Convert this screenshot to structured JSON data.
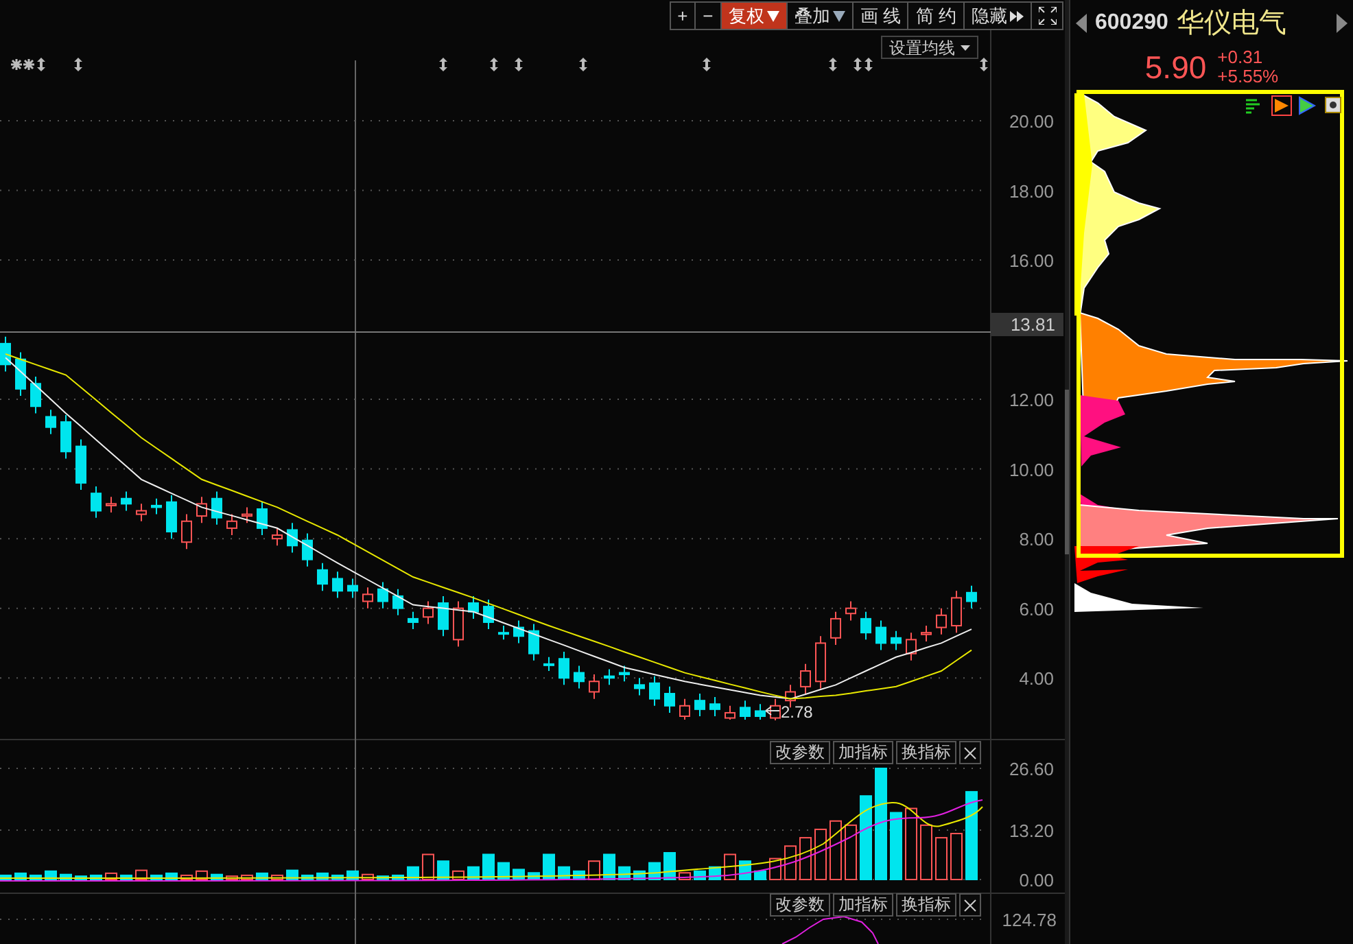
{
  "toolbar": {
    "buttons": [
      {
        "kind": "text",
        "label": "+",
        "selected": false
      },
      {
        "kind": "text",
        "label": "−",
        "selected": false
      },
      {
        "kind": "dropdown",
        "label": "复权",
        "selected": true
      },
      {
        "kind": "dropdown",
        "label": "叠加",
        "selected": false
      },
      {
        "kind": "text",
        "label": "画 线",
        "selected": false
      },
      {
        "kind": "text",
        "label": "简 约",
        "selected": false
      },
      {
        "kind": "expand",
        "label": "隐藏",
        "selected": false
      },
      {
        "kind": "fullscreen",
        "selected": false
      }
    ]
  },
  "price_chart": {
    "ma_button": "设置均线",
    "crosshair_price": "13.81",
    "low_label": "2.78",
    "chart_data": {
      "type": "candlestick",
      "grid": true,
      "ylim": [
        -3.64,
        22.6
      ],
      "yticks": [
        {
          "value": 20,
          "label": "20.00"
        },
        {
          "value": 18,
          "label": "18.00"
        },
        {
          "value": 16,
          "label": "16.00"
        },
        {
          "value": 12,
          "label": "12.00"
        },
        {
          "value": 10,
          "label": "10.00"
        },
        {
          "value": 8,
          "label": "8.00"
        },
        {
          "value": 6,
          "label": "6.00"
        },
        {
          "value": 4,
          "label": "4.00"
        }
      ],
      "ohlc": [
        [
          13.6,
          13.8,
          12.8,
          13.0
        ],
        [
          13.15,
          13.35,
          12.1,
          12.3
        ],
        [
          12.45,
          12.65,
          11.6,
          11.8
        ],
        [
          11.5,
          11.7,
          11.0,
          11.2
        ],
        [
          11.35,
          11.55,
          10.3,
          10.5
        ],
        [
          10.65,
          10.85,
          9.4,
          9.6
        ],
        [
          9.3,
          9.5,
          8.6,
          8.8
        ],
        [
          8.95,
          9.2,
          8.75,
          9.0
        ],
        [
          9.15,
          9.35,
          8.8,
          9.0
        ],
        [
          8.7,
          9.0,
          8.5,
          8.8
        ],
        [
          8.95,
          9.15,
          8.7,
          8.9
        ],
        [
          9.05,
          9.25,
          8.0,
          8.2
        ],
        [
          7.9,
          8.7,
          7.7,
          8.5
        ],
        [
          8.65,
          9.2,
          8.45,
          9.0
        ],
        [
          9.15,
          9.35,
          8.4,
          8.6
        ],
        [
          8.3,
          8.7,
          8.1,
          8.5
        ],
        [
          8.65,
          8.9,
          8.45,
          8.7
        ],
        [
          8.85,
          9.05,
          8.1,
          8.3
        ],
        [
          8.0,
          8.3,
          7.8,
          8.1
        ],
        [
          8.25,
          8.45,
          7.6,
          7.8
        ],
        [
          7.95,
          8.15,
          7.2,
          7.4
        ],
        [
          7.1,
          7.3,
          6.5,
          6.7
        ],
        [
          6.85,
          7.05,
          6.3,
          6.5
        ],
        [
          6.65,
          6.85,
          6.3,
          6.5
        ],
        [
          6.2,
          6.6,
          6.0,
          6.4
        ],
        [
          6.55,
          6.75,
          6.0,
          6.2
        ],
        [
          6.35,
          6.55,
          5.8,
          6.0
        ],
        [
          5.7,
          5.9,
          5.4,
          5.6
        ],
        [
          5.75,
          6.2,
          5.55,
          6.0
        ],
        [
          6.15,
          6.35,
          5.2,
          5.4
        ],
        [
          5.1,
          6.2,
          4.9,
          6.0
        ],
        [
          6.15,
          6.35,
          5.7,
          5.9
        ],
        [
          6.05,
          6.25,
          5.4,
          5.6
        ],
        [
          5.3,
          5.5,
          5.1,
          5.3
        ],
        [
          5.45,
          5.65,
          5.0,
          5.2
        ],
        [
          5.35,
          5.55,
          4.5,
          4.7
        ],
        [
          4.4,
          4.6,
          4.2,
          4.4
        ],
        [
          4.55,
          4.75,
          3.8,
          4.0
        ],
        [
          4.15,
          4.35,
          3.7,
          3.9
        ],
        [
          3.6,
          4.1,
          3.4,
          3.9
        ],
        [
          4.05,
          4.25,
          3.8,
          4.0
        ],
        [
          4.15,
          4.35,
          3.9,
          4.1
        ],
        [
          3.8,
          4.0,
          3.5,
          3.7
        ],
        [
          3.85,
          4.05,
          3.2,
          3.4
        ],
        [
          3.55,
          3.75,
          3.0,
          3.2
        ],
        [
          2.9,
          3.4,
          2.8,
          3.2
        ],
        [
          3.35,
          3.55,
          2.9,
          3.1
        ],
        [
          3.25,
          3.45,
          2.9,
          3.1
        ],
        [
          2.85,
          3.2,
          2.8,
          3.0
        ],
        [
          3.15,
          3.35,
          2.8,
          2.9
        ],
        [
          3.05,
          3.25,
          2.8,
          2.9
        ],
        [
          2.85,
          3.4,
          2.78,
          3.2
        ],
        [
          3.35,
          3.8,
          3.15,
          3.6
        ],
        [
          3.75,
          4.4,
          3.55,
          4.2
        ],
        [
          3.9,
          5.2,
          3.7,
          5.0
        ],
        [
          5.15,
          5.9,
          4.95,
          5.7
        ],
        [
          5.85,
          6.2,
          5.65,
          6.0
        ],
        [
          5.7,
          5.9,
          5.1,
          5.3
        ],
        [
          5.45,
          5.65,
          4.8,
          5.0
        ],
        [
          5.15,
          5.35,
          4.8,
          5.0
        ],
        [
          4.7,
          5.3,
          4.5,
          5.1
        ],
        [
          5.25,
          5.5,
          5.05,
          5.3
        ],
        [
          5.45,
          6.0,
          5.25,
          5.8
        ],
        [
          5.5,
          6.5,
          5.3,
          6.3
        ],
        [
          6.45,
          6.65,
          6.0,
          6.2
        ]
      ],
      "series": [
        {
          "type": "line",
          "color": "#eeeeee",
          "values": [
            13.2,
            12.8,
            12.4,
            12.0,
            11.6,
            11.22,
            10.84,
            10.46,
            10.08,
            9.7,
            9.5,
            9.3,
            9.1,
            8.9,
            8.78,
            8.66,
            8.54,
            8.42,
            8.3,
            8.05,
            7.8,
            7.55,
            7.3,
            7.06,
            6.82,
            6.58,
            6.34,
            6.1,
            6.05,
            6.0,
            5.95,
            5.9,
            5.74,
            5.58,
            5.42,
            5.26,
            5.1,
            4.94,
            4.78,
            4.62,
            4.46,
            4.3,
            4.2,
            4.1,
            4.0,
            3.9,
            3.82,
            3.74,
            3.66,
            3.58,
            3.5,
            3.45,
            3.4,
            3.53,
            3.67,
            3.8,
            4.0,
            4.2,
            4.4,
            4.6,
            4.73,
            4.87,
            5.0,
            5.2,
            5.4
          ]
        },
        {
          "type": "line",
          "color": "#e8e800",
          "values": [
            13.3,
            13.15,
            13.0,
            12.85,
            12.7,
            12.34,
            11.98,
            11.62,
            11.26,
            10.9,
            10.6,
            10.3,
            10.0,
            9.7,
            9.54,
            9.38,
            9.22,
            9.06,
            8.9,
            8.7,
            8.5,
            8.3,
            8.1,
            7.86,
            7.62,
            7.38,
            7.14,
            6.9,
            6.75,
            6.6,
            6.45,
            6.3,
            6.14,
            5.98,
            5.82,
            5.66,
            5.5,
            5.35,
            5.2,
            5.05,
            4.9,
            4.75,
            4.6,
            4.45,
            4.3,
            4.15,
            4.04,
            3.93,
            3.82,
            3.71,
            3.6,
            3.5,
            3.4,
            3.43,
            3.47,
            3.5,
            3.56,
            3.63,
            3.69,
            3.75,
            3.9,
            4.05,
            4.2,
            4.5,
            4.8
          ]
        }
      ]
    }
  },
  "volume_panel": {
    "buttons": [
      "改参数",
      "加指标",
      "换指标"
    ],
    "axis": [
      "26.60",
      "13.20",
      "0.00"
    ]
  },
  "indicator_panel": {
    "buttons": [
      "改参数",
      "加指标",
      "换指标"
    ],
    "axis": [
      "124.78"
    ]
  },
  "quote": {
    "code": "600290",
    "name": "华仪电气",
    "price": "5.90",
    "change": "+0.31",
    "change_pct": "+5.55%"
  }
}
